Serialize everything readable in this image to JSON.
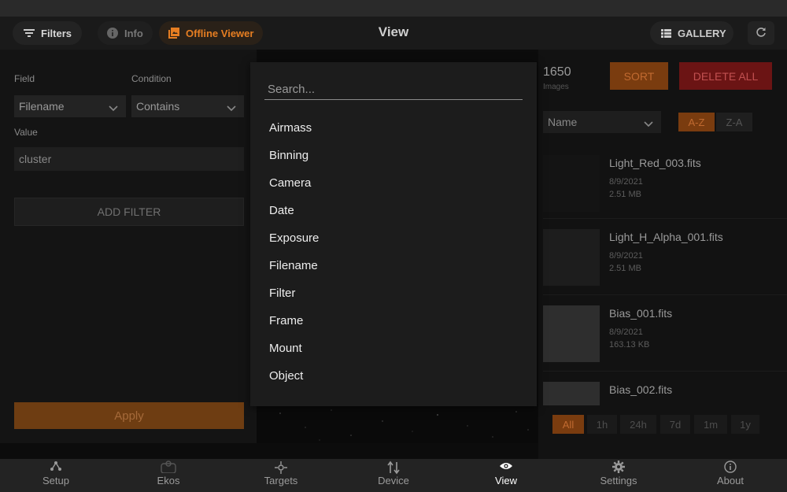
{
  "topbar": {
    "filters_label": "Filters",
    "info_label": "Info",
    "offline_viewer_label": "Offline Viewer",
    "title": "View",
    "gallery_label": "GALLERY"
  },
  "filter_panel": {
    "field_label": "Field",
    "field_value": "Filename",
    "condition_label": "Condition",
    "condition_value": "Contains",
    "value_label": "Value",
    "value_text": "cluster",
    "add_filter_label": "ADD FILTER",
    "apply_label": "Apply"
  },
  "dialog": {
    "search_placeholder": "Search...",
    "items": [
      "Airmass",
      "Binning",
      "Camera",
      "Date",
      "Exposure",
      "Filename",
      "Filter",
      "Frame",
      "Mount",
      "Object"
    ]
  },
  "gallery": {
    "count": "1650",
    "count_label": "Images",
    "sort_label": "SORT",
    "delete_all_label": "DELETE ALL",
    "sort_field": "Name",
    "az_label": "A-Z",
    "za_label": "Z-A",
    "files": [
      {
        "name": "Light_Red_003.fits",
        "date": "8/9/2021",
        "size": "2.51 MB"
      },
      {
        "name": "Light_H_Alpha_001.fits",
        "date": "8/9/2021",
        "size": "2.51 MB"
      },
      {
        "name": "Bias_001.fits",
        "date": "8/9/2021",
        "size": "163.13 KB"
      },
      {
        "name": "Bias_002.fits",
        "date": "",
        "size": ""
      }
    ],
    "time_filters": [
      "All",
      "1h",
      "24h",
      "7d",
      "1m",
      "1y"
    ],
    "active_time_filter": "All"
  },
  "bottom_nav": {
    "items": [
      {
        "label": "Setup",
        "icon": "setup-icon"
      },
      {
        "label": "Ekos",
        "icon": "ekos-icon"
      },
      {
        "label": "Targets",
        "icon": "targets-icon"
      },
      {
        "label": "Device",
        "icon": "device-icon"
      },
      {
        "label": "View",
        "icon": "eye-icon"
      },
      {
        "label": "Settings",
        "icon": "gear-icon"
      },
      {
        "label": "About",
        "icon": "info-icon"
      }
    ],
    "active": "View"
  },
  "colors": {
    "accent_orange": "#e67e22",
    "danger_red": "#6b1414",
    "background": "#101010"
  }
}
